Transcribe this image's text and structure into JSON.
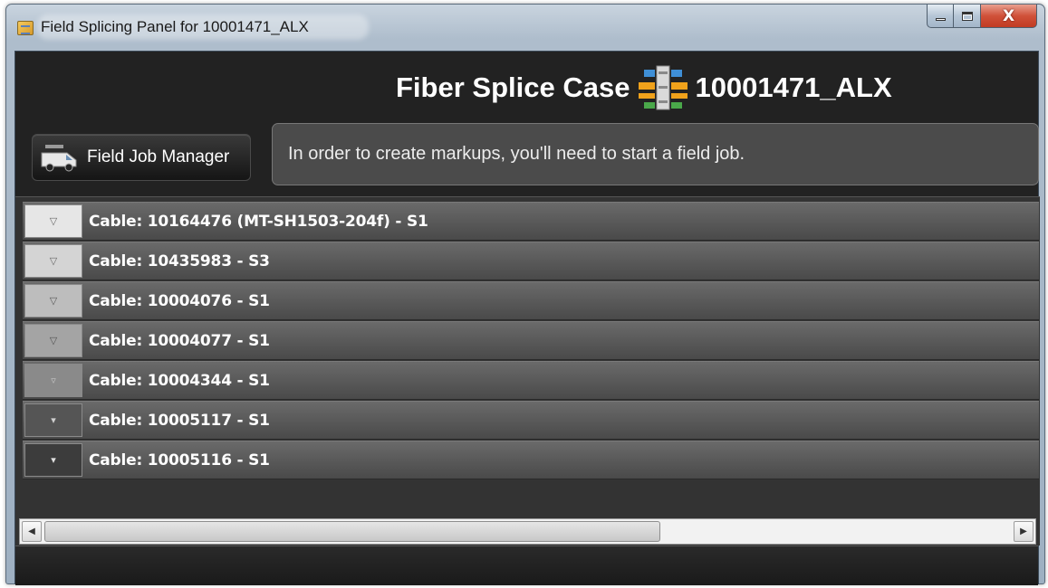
{
  "window": {
    "title": "Field Splicing Panel for 10001471_ALX",
    "close_glyph": "X"
  },
  "header": {
    "title_prefix": "Fiber Splice Case",
    "title_id": "10001471_ALX",
    "icon": "fiber-splice-case-icon"
  },
  "toolbar": {
    "field_job_label": "Field Job Manager",
    "field_job_icon": "truck-icon"
  },
  "message": {
    "text": "In order to create markups, you'll need to start a field job."
  },
  "cables": [
    {
      "label": "Cable: 10164476 (MT-SH1503-204f) - S1",
      "expander_bg": "#e6e6e6",
      "arrow": "▽"
    },
    {
      "label": "Cable: 10435983 - S3",
      "expander_bg": "#d4d4d4",
      "arrow": "▽"
    },
    {
      "label": "Cable: 10004076 - S1",
      "expander_bg": "#bdbdbd",
      "arrow": "▽"
    },
    {
      "label": "Cable: 10004077 - S1",
      "expander_bg": "#a4a4a4",
      "arrow": "▽"
    },
    {
      "label": "Cable: 10004344 - S1",
      "expander_bg": "#8a8a8a",
      "arrow": "▿"
    },
    {
      "label": "Cable: 10005117 - S1",
      "expander_bg": "#555555",
      "arrow": "▾"
    },
    {
      "label": "Cable: 10005116 - S1",
      "expander_bg": "#3c3c3c",
      "arrow": "▾"
    }
  ],
  "scrollbar": {
    "left_arrow": "◀",
    "right_arrow": "▶"
  },
  "colors": {
    "background": "#202020",
    "row": "#585858",
    "message_box": "#4b4b4b",
    "close_button": "#c13b22"
  }
}
